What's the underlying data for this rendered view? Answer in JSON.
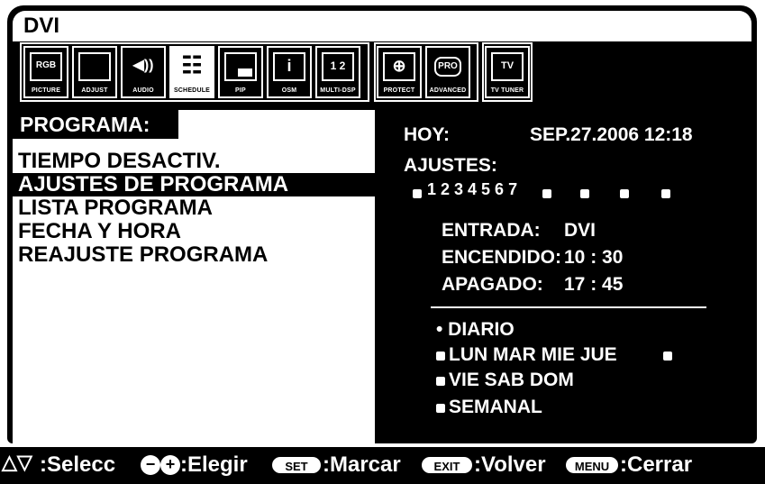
{
  "title": "DVI",
  "icons": [
    {
      "label": "PICTURE",
      "glyph": "RGB"
    },
    {
      "label": "ADJUST",
      "glyph": ""
    },
    {
      "label": "AUDIO",
      "glyph": "◀))"
    },
    {
      "label": "SCHEDULE",
      "glyph": "☷"
    },
    {
      "label": "PIP",
      "glyph": "▬"
    },
    {
      "label": "OSM",
      "glyph": "i"
    },
    {
      "label": "MULTI-DSP",
      "glyph": "1 2"
    },
    {
      "label": "PROTECT",
      "glyph": "⊕"
    },
    {
      "label": "ADVANCED",
      "glyph": "PRO"
    },
    {
      "label": "TV TUNER",
      "glyph": "TV"
    }
  ],
  "menu": {
    "title": "PROGRAMA:",
    "items": [
      "TIEMPO DESACTIV.",
      "AJUSTES DE PROGRAMA",
      "LISTA PROGRAMA",
      "FECHA Y HORA",
      "REAJUSTE PROGRAMA"
    ]
  },
  "info": {
    "today_label": "HOY:",
    "today_value": "SEP.27.2006 12:18",
    "settings_label": "AJUSTES:",
    "slots": "1 2 3 4 5 6 7",
    "input_label": "ENTRADA:",
    "input_value": "DVI",
    "on_label": "ENCENDIDO:",
    "on_value": "10 : 30",
    "off_label": "APAGADO:",
    "off_value": "17 : 45",
    "daily": "• DIARIO",
    "days_row1": "LUN  MAR  MIE  JUE",
    "days_row2": "VIE  SAB  DOM",
    "weekly": "SEMANAL"
  },
  "footer": {
    "select": ":Selecc",
    "choose": ":Elegir",
    "set_key": "SET",
    "mark": ":Marcar",
    "exit_key": "EXIT",
    "back": ":Volver",
    "menu_key": "MENU",
    "close": ":Cerrar"
  }
}
